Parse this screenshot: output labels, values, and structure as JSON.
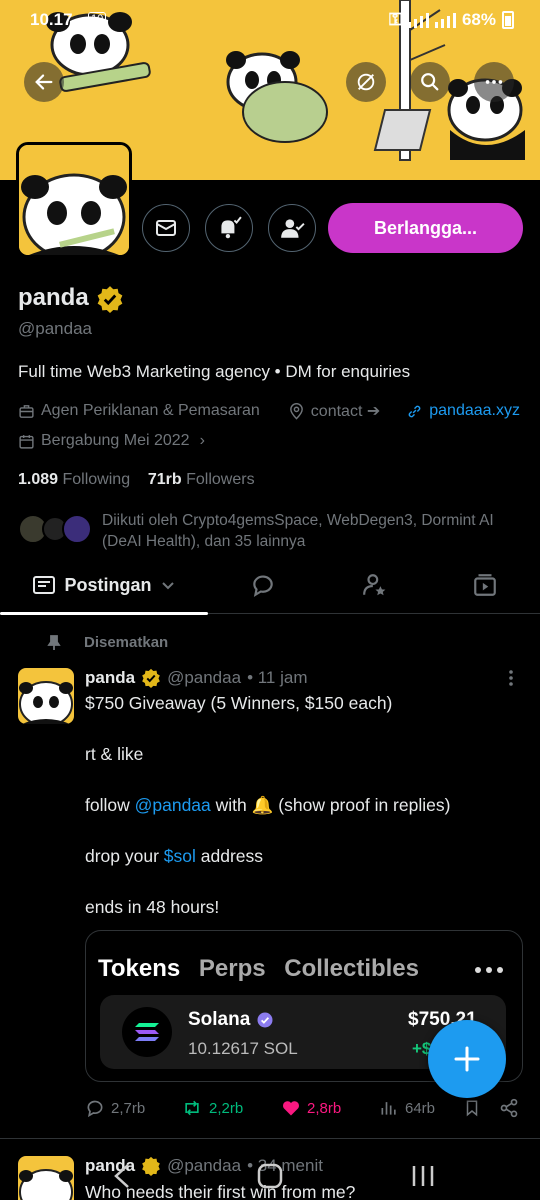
{
  "status_bar": {
    "time": "10.17",
    "time_badge": "10",
    "battery": "68%"
  },
  "profile": {
    "name": "panda",
    "handle": "@pandaa",
    "bio": "Full time Web3 Marketing agency • DM for enquiries",
    "category": "Agen Periklanan & Pemasaran",
    "contact": "contact",
    "website": "pandaaa.xyz",
    "joined": "Bergabung Mei 2022",
    "following_count": "1.089",
    "following_label": "Following",
    "followers_count": "71rb",
    "followers_label": "Followers",
    "followed_by": "Diikuti oleh Crypto4gemsSpace, WebDegen3, Dormint AI (DeAI Health), dan 35 lainnya",
    "subscribe_label": "Berlangga..."
  },
  "tabs": {
    "posts_label": "Postingan"
  },
  "pinned_label": "Disematkan",
  "tweet": {
    "name": "panda",
    "handle": "@pandaa",
    "time": "• 11 jam",
    "line1": "$750 Giveaway (5 Winners, $150 each)",
    "line2": "rt & like",
    "line3_a": "follow ",
    "line3_mention": "@pandaa",
    "line3_b": " with 🔔 (show proof in replies)",
    "line4_a": "drop your ",
    "line4_cashtag": "$sol",
    "line4_b": " address",
    "line5": "ends in 48 hours!",
    "card": {
      "tab1": "Tokens",
      "tab2": "Perps",
      "tab3": "Collectibles",
      "token_name": "Solana",
      "token_amount": "10.12617 SOL",
      "token_value": "$750.21",
      "token_change": "+$"
    },
    "replies": "2,7rb",
    "reposts": "2,2rb",
    "likes": "2,8rb",
    "views": "64rb"
  },
  "next_tweet": {
    "name": "panda",
    "handle": "@pandaa",
    "time": "• 34 menit",
    "text": "Who needs their first win from me?"
  },
  "colors": {
    "accent": "#1d9bf0",
    "subscribe": "#c936c9",
    "banner": "#f4c43c",
    "like": "#f91880",
    "repost": "#00ba7c",
    "verified": "#e2b719"
  }
}
